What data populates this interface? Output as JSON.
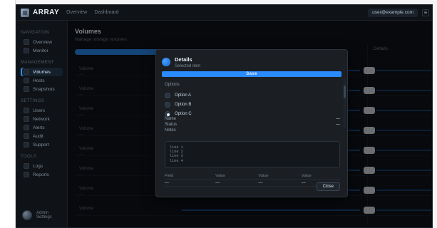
{
  "colors": {
    "app_bg": "#0f1216",
    "accent": "#2a8bff",
    "modal_bg": "#1b1f24"
  },
  "topbar": {
    "brand": "ARRAY",
    "nav": [
      "Overview",
      "Dashboard"
    ],
    "user": "user@example.com",
    "icons": [
      "user-icon",
      "menu-icon"
    ]
  },
  "sidebar": {
    "sections": [
      {
        "title": "Navigation",
        "items": [
          {
            "label": "Overview",
            "icon": "home-icon"
          },
          {
            "label": "Monitor",
            "icon": "chart-icon"
          }
        ]
      },
      {
        "title": "Management",
        "items": [
          {
            "label": "Volumes",
            "icon": "disk-icon",
            "active": true
          },
          {
            "label": "Hosts",
            "icon": "server-icon"
          },
          {
            "label": "Snapshots",
            "icon": "camera-icon"
          }
        ]
      },
      {
        "title": "Settings",
        "items": [
          {
            "label": "Users",
            "icon": "users-icon"
          },
          {
            "label": "Network",
            "icon": "network-icon"
          },
          {
            "label": "Alerts",
            "icon": "bell-icon"
          },
          {
            "label": "Audit",
            "icon": "list-icon"
          },
          {
            "label": "Support",
            "icon": "help-icon"
          }
        ]
      },
      {
        "title": "Tools",
        "items": [
          {
            "label": "Logs",
            "icon": "file-icon"
          },
          {
            "label": "Reports",
            "icon": "report-icon"
          }
        ]
      }
    ],
    "bottom": {
      "label": "Admin",
      "sub": "Settings"
    }
  },
  "main": {
    "title": "Volumes",
    "subtitle": "Manage storage volumes",
    "right_panel_title": "Details",
    "rows": [
      {
        "label": "Volume",
        "sub": "—"
      },
      {
        "label": "Volume",
        "sub": "—"
      },
      {
        "label": "Volume",
        "sub": "—"
      },
      {
        "label": "Volume",
        "sub": "—"
      },
      {
        "label": "Volume",
        "sub": "—"
      },
      {
        "label": "Volume",
        "sub": "—"
      },
      {
        "label": "Volume",
        "sub": "—"
      },
      {
        "label": "Volume",
        "sub": "—"
      }
    ]
  },
  "modal": {
    "title": "Details",
    "subtitle": "Selected item",
    "primary_label": "Save",
    "section_label": "Options",
    "options": [
      {
        "label": "Option A",
        "checked": false
      },
      {
        "label": "Option B",
        "checked": false
      },
      {
        "label": "Option C",
        "checked": true
      }
    ],
    "kv": [
      {
        "k": "Name",
        "v": "—"
      },
      {
        "k": "Status",
        "v": "—"
      }
    ],
    "note_label": "Notes",
    "code_lines": [
      "line 1",
      "line 2",
      "line 3",
      "line 4"
    ],
    "table": {
      "headers": [
        "Field",
        "Value",
        "Value",
        "Value"
      ],
      "row": [
        "—",
        "—",
        "—",
        "—"
      ]
    },
    "footer_button": "Close"
  }
}
